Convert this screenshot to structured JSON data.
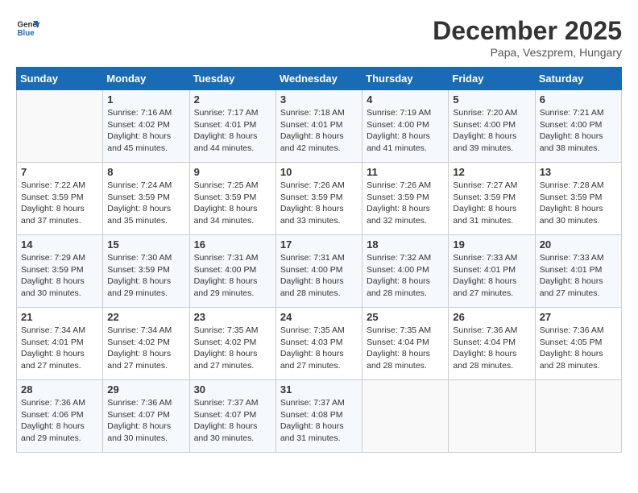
{
  "logo": {
    "line1": "General",
    "line2": "Blue"
  },
  "title": "December 2025",
  "subtitle": "Papa, Veszprem, Hungary",
  "days_of_week": [
    "Sunday",
    "Monday",
    "Tuesday",
    "Wednesday",
    "Thursday",
    "Friday",
    "Saturday"
  ],
  "weeks": [
    [
      {
        "day": "",
        "info": ""
      },
      {
        "day": "1",
        "info": "Sunrise: 7:16 AM\nSunset: 4:02 PM\nDaylight: 8 hours\nand 45 minutes."
      },
      {
        "day": "2",
        "info": "Sunrise: 7:17 AM\nSunset: 4:01 PM\nDaylight: 8 hours\nand 44 minutes."
      },
      {
        "day": "3",
        "info": "Sunrise: 7:18 AM\nSunset: 4:01 PM\nDaylight: 8 hours\nand 42 minutes."
      },
      {
        "day": "4",
        "info": "Sunrise: 7:19 AM\nSunset: 4:00 PM\nDaylight: 8 hours\nand 41 minutes."
      },
      {
        "day": "5",
        "info": "Sunrise: 7:20 AM\nSunset: 4:00 PM\nDaylight: 8 hours\nand 39 minutes."
      },
      {
        "day": "6",
        "info": "Sunrise: 7:21 AM\nSunset: 4:00 PM\nDaylight: 8 hours\nand 38 minutes."
      }
    ],
    [
      {
        "day": "7",
        "info": "Sunrise: 7:22 AM\nSunset: 3:59 PM\nDaylight: 8 hours\nand 37 minutes."
      },
      {
        "day": "8",
        "info": "Sunrise: 7:24 AM\nSunset: 3:59 PM\nDaylight: 8 hours\nand 35 minutes."
      },
      {
        "day": "9",
        "info": "Sunrise: 7:25 AM\nSunset: 3:59 PM\nDaylight: 8 hours\nand 34 minutes."
      },
      {
        "day": "10",
        "info": "Sunrise: 7:26 AM\nSunset: 3:59 PM\nDaylight: 8 hours\nand 33 minutes."
      },
      {
        "day": "11",
        "info": "Sunrise: 7:26 AM\nSunset: 3:59 PM\nDaylight: 8 hours\nand 32 minutes."
      },
      {
        "day": "12",
        "info": "Sunrise: 7:27 AM\nSunset: 3:59 PM\nDaylight: 8 hours\nand 31 minutes."
      },
      {
        "day": "13",
        "info": "Sunrise: 7:28 AM\nSunset: 3:59 PM\nDaylight: 8 hours\nand 30 minutes."
      }
    ],
    [
      {
        "day": "14",
        "info": "Sunrise: 7:29 AM\nSunset: 3:59 PM\nDaylight: 8 hours\nand 30 minutes."
      },
      {
        "day": "15",
        "info": "Sunrise: 7:30 AM\nSunset: 3:59 PM\nDaylight: 8 hours\nand 29 minutes."
      },
      {
        "day": "16",
        "info": "Sunrise: 7:31 AM\nSunset: 4:00 PM\nDaylight: 8 hours\nand 29 minutes."
      },
      {
        "day": "17",
        "info": "Sunrise: 7:31 AM\nSunset: 4:00 PM\nDaylight: 8 hours\nand 28 minutes."
      },
      {
        "day": "18",
        "info": "Sunrise: 7:32 AM\nSunset: 4:00 PM\nDaylight: 8 hours\nand 28 minutes."
      },
      {
        "day": "19",
        "info": "Sunrise: 7:33 AM\nSunset: 4:01 PM\nDaylight: 8 hours\nand 27 minutes."
      },
      {
        "day": "20",
        "info": "Sunrise: 7:33 AM\nSunset: 4:01 PM\nDaylight: 8 hours\nand 27 minutes."
      }
    ],
    [
      {
        "day": "21",
        "info": "Sunrise: 7:34 AM\nSunset: 4:01 PM\nDaylight: 8 hours\nand 27 minutes."
      },
      {
        "day": "22",
        "info": "Sunrise: 7:34 AM\nSunset: 4:02 PM\nDaylight: 8 hours\nand 27 minutes."
      },
      {
        "day": "23",
        "info": "Sunrise: 7:35 AM\nSunset: 4:02 PM\nDaylight: 8 hours\nand 27 minutes."
      },
      {
        "day": "24",
        "info": "Sunrise: 7:35 AM\nSunset: 4:03 PM\nDaylight: 8 hours\nand 27 minutes."
      },
      {
        "day": "25",
        "info": "Sunrise: 7:35 AM\nSunset: 4:04 PM\nDaylight: 8 hours\nand 28 minutes."
      },
      {
        "day": "26",
        "info": "Sunrise: 7:36 AM\nSunset: 4:04 PM\nDaylight: 8 hours\nand 28 minutes."
      },
      {
        "day": "27",
        "info": "Sunrise: 7:36 AM\nSunset: 4:05 PM\nDaylight: 8 hours\nand 28 minutes."
      }
    ],
    [
      {
        "day": "28",
        "info": "Sunrise: 7:36 AM\nSunset: 4:06 PM\nDaylight: 8 hours\nand 29 minutes."
      },
      {
        "day": "29",
        "info": "Sunrise: 7:36 AM\nSunset: 4:07 PM\nDaylight: 8 hours\nand 30 minutes."
      },
      {
        "day": "30",
        "info": "Sunrise: 7:37 AM\nSunset: 4:07 PM\nDaylight: 8 hours\nand 30 minutes."
      },
      {
        "day": "31",
        "info": "Sunrise: 7:37 AM\nSunset: 4:08 PM\nDaylight: 8 hours\nand 31 minutes."
      },
      {
        "day": "",
        "info": ""
      },
      {
        "day": "",
        "info": ""
      },
      {
        "day": "",
        "info": ""
      }
    ]
  ]
}
